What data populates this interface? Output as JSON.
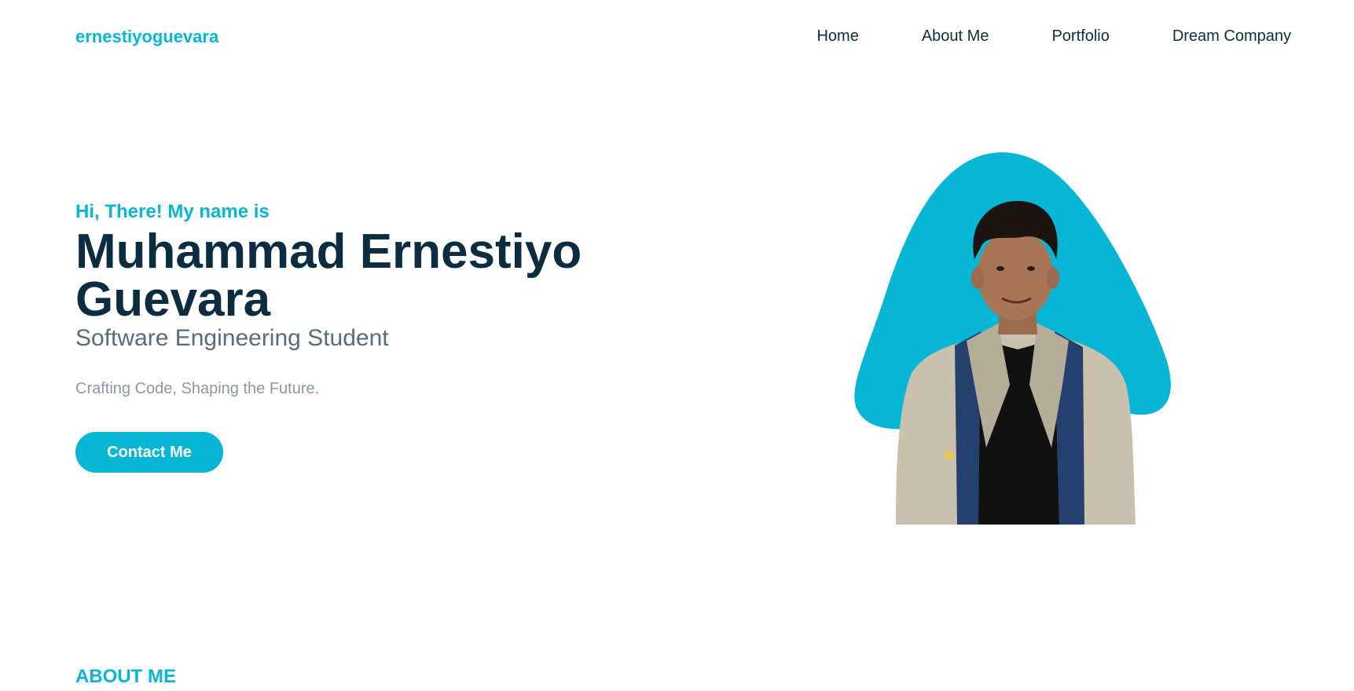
{
  "header": {
    "brand": "ernestiyoguevara",
    "nav": [
      "Home",
      "About Me",
      "Portfolio",
      "Dream Company"
    ]
  },
  "hero": {
    "greeting": "Hi, There! My name is",
    "name": "Muhammad Ernestiyo Guevara",
    "role": "Software Engineering Student",
    "tagline": "Crafting Code, Shaping the Future.",
    "cta_label": "Contact Me"
  },
  "about": {
    "title": "ABOUT ME"
  },
  "colors": {
    "accent": "#06b6d4",
    "heading": "#0c2c3f",
    "muted": "#5a6b7c"
  },
  "icons": {
    "portrait": "person-photo-on-blob"
  }
}
